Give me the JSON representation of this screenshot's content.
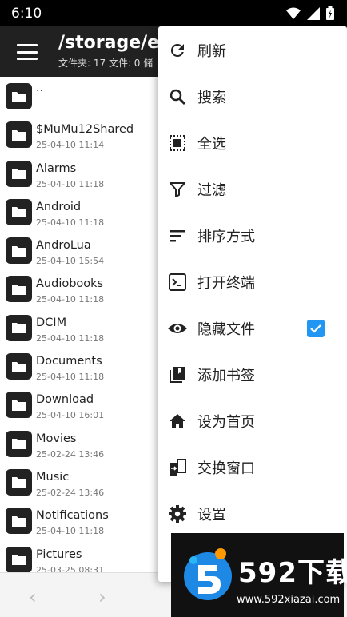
{
  "status_bar": {
    "time": "6:10"
  },
  "app_bar": {
    "title": "/storage/emu",
    "subtitle": "文件夹: 17  文件: 0  储"
  },
  "files": [
    {
      "name": "..",
      "date": ""
    },
    {
      "name": "$MuMu12Shared",
      "date": "25-04-10 11:14"
    },
    {
      "name": "Alarms",
      "date": "25-04-10 11:18"
    },
    {
      "name": "Android",
      "date": "25-04-10 11:18"
    },
    {
      "name": "AndroLua",
      "date": "25-04-10 15:54"
    },
    {
      "name": "Audiobooks",
      "date": "25-04-10 11:18"
    },
    {
      "name": "DCIM",
      "date": "25-04-10 11:18"
    },
    {
      "name": "Documents",
      "date": "25-04-10 11:18"
    },
    {
      "name": "Download",
      "date": "25-04-10 16:01"
    },
    {
      "name": "Movies",
      "date": "25-02-24 13:46"
    },
    {
      "name": "Music",
      "date": "25-02-24 13:46"
    },
    {
      "name": "Notifications",
      "date": "25-04-10 11:18"
    },
    {
      "name": "Pictures",
      "date": "25-03-25 08:31"
    }
  ],
  "bottom_bar": {
    "back": "‹",
    "forward": "›"
  },
  "menu": {
    "items": [
      {
        "label": "刷新",
        "icon": "refresh-icon"
      },
      {
        "label": "搜索",
        "icon": "search-icon"
      },
      {
        "label": "全选",
        "icon": "select-all-icon"
      },
      {
        "label": "过滤",
        "icon": "filter-icon"
      },
      {
        "label": "排序方式",
        "icon": "sort-icon"
      },
      {
        "label": "打开终端",
        "icon": "terminal-icon"
      },
      {
        "label": "隐藏文件",
        "icon": "eye-icon",
        "checked": true
      },
      {
        "label": "添加书签",
        "icon": "bookmark-add-icon"
      },
      {
        "label": "设为首页",
        "icon": "home-icon"
      },
      {
        "label": "交换窗口",
        "icon": "swap-window-icon"
      },
      {
        "label": "设置",
        "icon": "gear-icon"
      }
    ]
  },
  "watermark": {
    "brand": "592下载",
    "url": "www.592xiazai.com"
  }
}
